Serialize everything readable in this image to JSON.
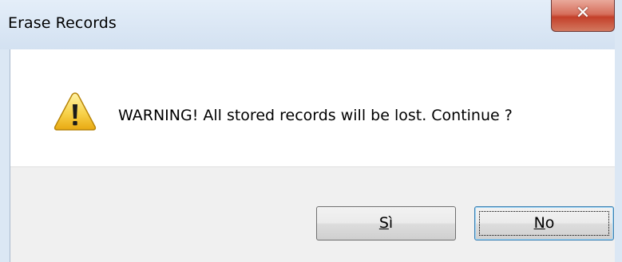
{
  "dialog": {
    "title": "Erase Records",
    "message": "WARNING! All stored records will be lost. Continue ?",
    "icon": "warning-icon",
    "colors": {
      "titlebar": "#dbe7f4",
      "close_button": "#c9462f",
      "button_area": "#f0f0f0"
    }
  },
  "buttons": {
    "yes": {
      "mnemonic": "S",
      "rest": "ì"
    },
    "no": {
      "mnemonic": "N",
      "rest": "o"
    }
  }
}
